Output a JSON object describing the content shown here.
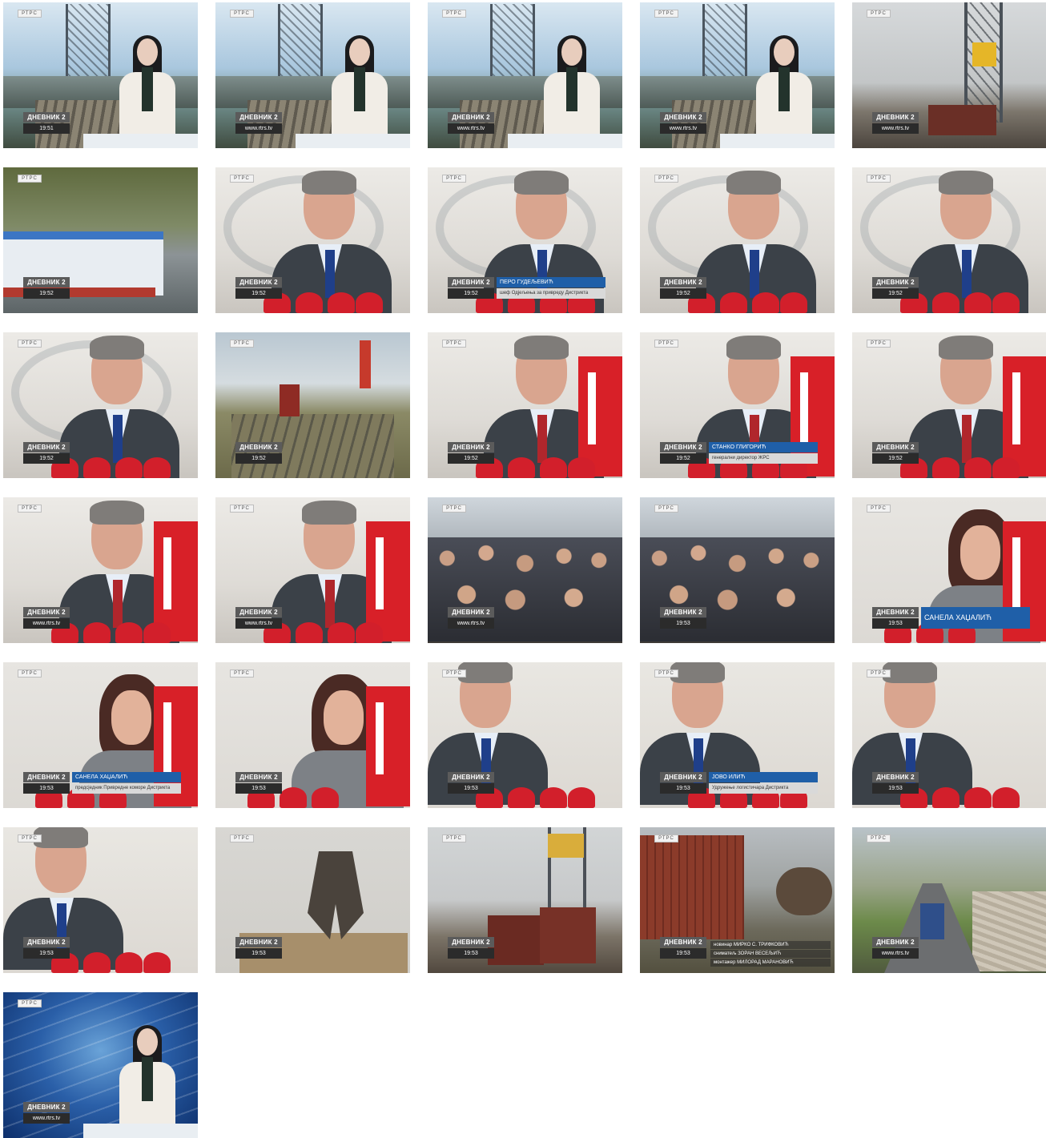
{
  "show_label": "ДНЕВНИК 2",
  "channel_bug": "РТРС",
  "thumbnails": [
    {
      "scene": "studio",
      "time": "19:51"
    },
    {
      "scene": "studio",
      "time": "www.rtrs.tv"
    },
    {
      "scene": "studio",
      "time": "www.rtrs.tv"
    },
    {
      "scene": "studio",
      "time": "www.rtrs.tv"
    },
    {
      "scene": "port",
      "time": "www.rtrs.tv"
    },
    {
      "scene": "boat",
      "time": "19:52"
    },
    {
      "scene": "interview-blue",
      "time": "19:52"
    },
    {
      "scene": "interview-blue",
      "time": "19:52",
      "name": "ПЕРО ГУДЕЉЕВИЋ",
      "role": "шеф Одјељења за привреду Дистрикта"
    },
    {
      "scene": "interview-blue",
      "time": "19:52"
    },
    {
      "scene": "interview-blue",
      "time": "19:52"
    },
    {
      "scene": "interview-blue",
      "time": "19:52"
    },
    {
      "scene": "rail",
      "time": "19:52"
    },
    {
      "scene": "interview-red",
      "time": "19:52"
    },
    {
      "scene": "interview-red",
      "time": "19:52",
      "name": "СТАНКО ГЛИГОРИЋ",
      "role": "генерални директор ЖРС"
    },
    {
      "scene": "interview-red",
      "time": "19:52"
    },
    {
      "scene": "interview-red",
      "time": "www.rtrs.tv"
    },
    {
      "scene": "interview-red",
      "time": "www.rtrs.tv"
    },
    {
      "scene": "crowd",
      "time": "www.rtrs.tv"
    },
    {
      "scene": "crowd",
      "time": "19:53"
    },
    {
      "scene": "woman",
      "time": "19:53",
      "name": "САНЕЛА ХАЏАЛИЋ",
      "big": true
    },
    {
      "scene": "woman",
      "time": "19:53",
      "name": "САНЕЛА ХАЏАЛИЋ",
      "role": "предсједник Привредне коморе Дистрикта"
    },
    {
      "scene": "woman",
      "time": "19:53"
    },
    {
      "scene": "man3",
      "time": "19:53"
    },
    {
      "scene": "man3",
      "time": "19:53",
      "name": "ЈОВО ИЛИЋ",
      "role": "Удружење логистичара Дистрикта"
    },
    {
      "scene": "man3",
      "time": "19:53"
    },
    {
      "scene": "man3",
      "time": "19:53"
    },
    {
      "scene": "grab",
      "time": "19:53"
    },
    {
      "scene": "port2",
      "time": "19:53"
    },
    {
      "scene": "containers",
      "time": "19:53",
      "credits": [
        "новинар МИРКО С. ТРИФКОВИЋ",
        "сниматељ ЗОРАН ВЕСЕЉИЋ",
        "монтажер МИЛОРАД МАРАНОВИЋ"
      ]
    },
    {
      "scene": "road",
      "time": "www.rtrs.tv"
    },
    {
      "scene": "studio2",
      "time": "www.rtrs.tv"
    }
  ],
  "colors": {
    "lower_third": "#1f5fa8",
    "mic": "#d21f2b"
  }
}
